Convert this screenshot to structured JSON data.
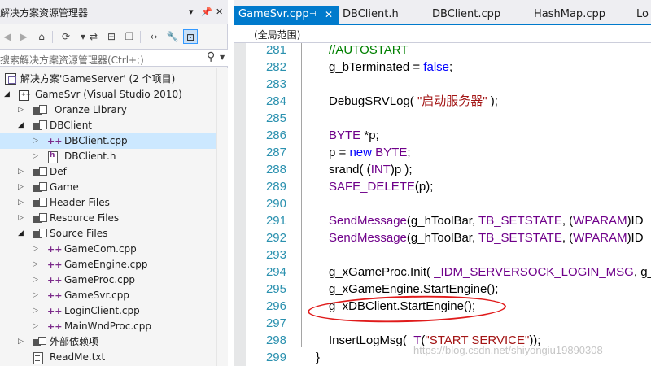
{
  "solution_explorer": {
    "title": "解决方案资源管理器",
    "search_placeholder": "搜索解决方案资源管理器(Ctrl+;)",
    "tree": [
      {
        "label": "解决方案'GameServer' (2 个项目)",
        "icon": "solution-icon",
        "expanded": null,
        "selected": false
      },
      {
        "label": "GameSvr (Visual Studio 2010)",
        "icon": "project-icon",
        "expanded": true,
        "selected": false
      },
      {
        "label": "_Oranze Library",
        "icon": "folder-icon",
        "expanded": false,
        "selected": false
      },
      {
        "label": "DBClient",
        "icon": "folder-icon",
        "expanded": true,
        "selected": false
      },
      {
        "label": "DBClient.cpp",
        "icon": "cpp-file-icon",
        "expanded": false,
        "selected": true
      },
      {
        "label": "DBClient.h",
        "icon": "header-file-icon",
        "expanded": false,
        "selected": false
      },
      {
        "label": "Def",
        "icon": "folder-icon",
        "expanded": false,
        "selected": false
      },
      {
        "label": "Game",
        "icon": "folder-icon",
        "expanded": false,
        "selected": false
      },
      {
        "label": "Header Files",
        "icon": "folder-icon",
        "expanded": false,
        "selected": false
      },
      {
        "label": "Resource Files",
        "icon": "folder-icon",
        "expanded": false,
        "selected": false
      },
      {
        "label": "Source Files",
        "icon": "folder-icon",
        "expanded": true,
        "selected": false
      },
      {
        "label": "GameCom.cpp",
        "icon": "cpp-file-icon",
        "expanded": false,
        "selected": false
      },
      {
        "label": "GameEngine.cpp",
        "icon": "cpp-file-icon",
        "expanded": false,
        "selected": false
      },
      {
        "label": "GameProc.cpp",
        "icon": "cpp-file-icon",
        "expanded": false,
        "selected": false
      },
      {
        "label": "GameSvr.cpp",
        "icon": "cpp-file-icon",
        "expanded": false,
        "selected": false
      },
      {
        "label": "LoginClient.cpp",
        "icon": "cpp-file-icon",
        "expanded": false,
        "selected": false
      },
      {
        "label": "MainWndProc.cpp",
        "icon": "cpp-file-icon",
        "expanded": false,
        "selected": false
      },
      {
        "label": "外部依赖项",
        "icon": "external-deps-icon",
        "expanded": false,
        "selected": false
      },
      {
        "label": "ReadMe.txt",
        "icon": "text-file-icon",
        "expanded": null,
        "selected": false
      }
    ]
  },
  "editor": {
    "tabs": [
      {
        "label": "GameSvr.cpp",
        "active": true
      },
      {
        "label": "DBClient.h",
        "active": false
      },
      {
        "label": "DBClient.cpp",
        "active": false
      },
      {
        "label": "HashMap.cpp",
        "active": false
      },
      {
        "label": "Lo",
        "active": false
      }
    ],
    "scope": "(全局范围)",
    "lines": [
      {
        "n": "281",
        "text": "//AUTOSTART"
      },
      {
        "n": "282",
        "text": "g_bTerminated = false;"
      },
      {
        "n": "283",
        "text": ""
      },
      {
        "n": "284",
        "text": "DebugSRVLog( \"启动服务器\" );"
      },
      {
        "n": "285",
        "text": ""
      },
      {
        "n": "286",
        "text": "BYTE *p;"
      },
      {
        "n": "287",
        "text": "p = new BYTE;"
      },
      {
        "n": "288",
        "text": "srand( (INT)p );"
      },
      {
        "n": "289",
        "text": "SAFE_DELETE(p);"
      },
      {
        "n": "290",
        "text": ""
      },
      {
        "n": "291",
        "text": "SendMessage(g_hToolBar, TB_SETSTATE, (WPARAM)ID"
      },
      {
        "n": "292",
        "text": "SendMessage(g_hToolBar, TB_SETSTATE, (WPARAM)ID"
      },
      {
        "n": "293",
        "text": ""
      },
      {
        "n": "294",
        "text": "g_xGameProc.Init( _IDM_SERVERSOCK_LOGIN_MSG, g_"
      },
      {
        "n": "295",
        "text": "g_xGameEngine.StartEngine();"
      },
      {
        "n": "296",
        "text": "g_xDBClient.StartEngine();"
      },
      {
        "n": "297",
        "text": ""
      },
      {
        "n": "298",
        "text": "InsertLogMsg(_T(\"START SERVICE\"));"
      },
      {
        "n": "299",
        "text": "}"
      }
    ]
  },
  "watermark": "https://blog.csdn.net/shiyongiu19890308",
  "colors": {
    "accent": "#007acc",
    "selection": "#cce8ff",
    "keyword": "#0000ff",
    "macro": "#6f008a",
    "string": "#a31515",
    "comment": "#008000",
    "line_number": "#2b91af",
    "annotation_ellipse": "#e01b1b"
  }
}
